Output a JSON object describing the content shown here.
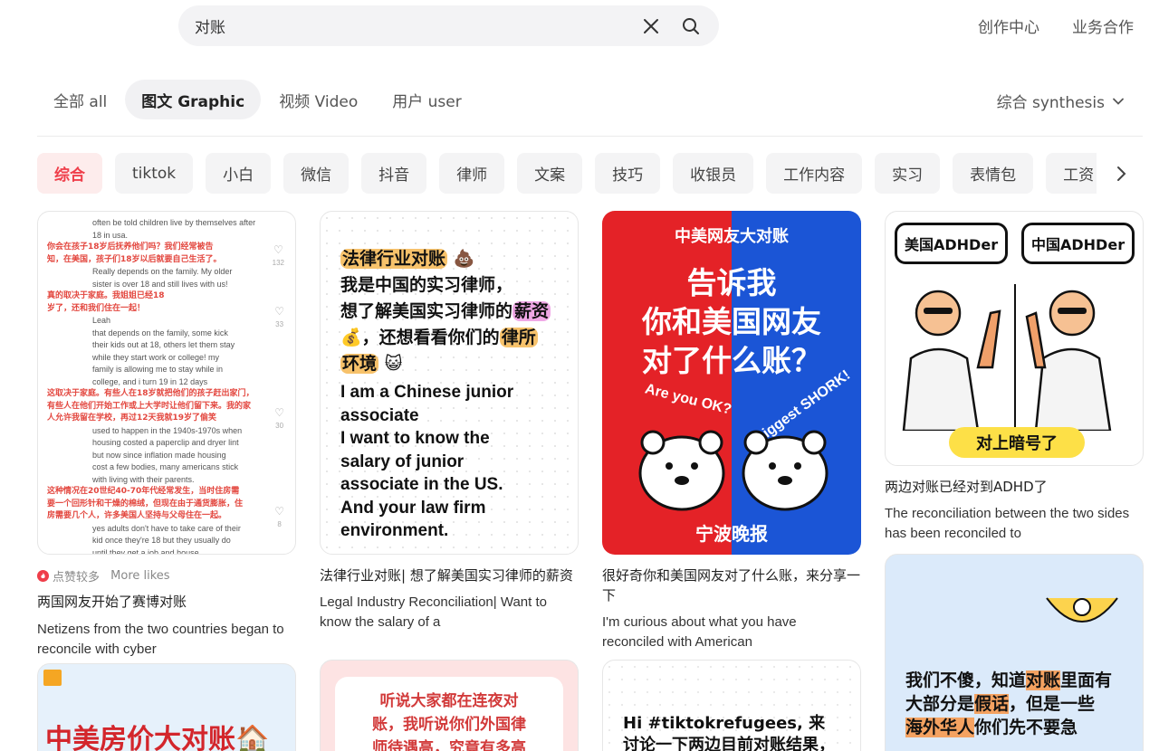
{
  "search": {
    "query": "对账"
  },
  "toplinks": [
    "创作中心",
    "业务合作"
  ],
  "tabs": [
    {
      "label": "全部  all",
      "active": false
    },
    {
      "label": "图文  Graphic",
      "active": true
    },
    {
      "label": "视频  Video",
      "active": false
    },
    {
      "label": "用户  user",
      "active": false
    }
  ],
  "sort_label": "综合  synthesis",
  "chips": [
    "综合",
    "tiktok",
    "小白",
    "微信",
    "抖音",
    "律师",
    "文案",
    "技巧",
    "收银员",
    "工作内容",
    "实习",
    "表情包",
    "工资"
  ],
  "cards": [
    {
      "likes_badge": "点赞较多",
      "likes_badge_en": "More likes",
      "title": "两国网友开始了赛博对账",
      "title_en": "Netizens from the two countries began to reconcile with cyber",
      "cover": {
        "lines": [
          {
            "t": "often be told children live by themselves after",
            "c": "en"
          },
          {
            "t": "18 in usa.",
            "c": "en"
          },
          {
            "t": "你会在孩子18岁后抚养他们吗？我们经常被告",
            "c": "red"
          },
          {
            "t": "知，在美国，孩子们18岁以后就要自己生活了。",
            "c": "red"
          },
          {
            "t": "Really depends on the family. My older",
            "c": "en"
          },
          {
            "t": "sister is over 18 and still lives with us!",
            "c": "en"
          },
          {
            "t": "真的取决于家庭。我姐姐已经18",
            "c": "red"
          },
          {
            "t": "岁了，还和我们住在一起！",
            "c": "red"
          },
          {
            "t": "Leah",
            "c": "en"
          },
          {
            "t": "that depends on the family, some kick",
            "c": "en"
          },
          {
            "t": "their kids out at 18, others let them stay",
            "c": "en"
          },
          {
            "t": "while they start work or college! my",
            "c": "en"
          },
          {
            "t": "family is allowing me to stay while in",
            "c": "en"
          },
          {
            "t": "college, and i turn 19 in 12 days",
            "c": "en"
          },
          {
            "t": "这取决于家庭。有些人在18岁就把他们的孩子赶出家门，",
            "c": "red"
          },
          {
            "t": "有些人在他们开始工作或上大学时让他们留下来。我的家",
            "c": "red"
          },
          {
            "t": "人允许我留在学校，再过12天我就19岁了偷笑",
            "c": "red"
          },
          {
            "t": "used to happen in the 1940s-1970s when",
            "c": "en"
          },
          {
            "t": "housing costed a paperclip and dryer lint",
            "c": "en"
          },
          {
            "t": "but now since inflation made housing",
            "c": "en"
          },
          {
            "t": "cost a few bodies, many americans stick",
            "c": "en"
          },
          {
            "t": "with living with their parents.",
            "c": "en"
          },
          {
            "t": "这种情况在20世纪40-70年代经常发生，当时住房需",
            "c": "red"
          },
          {
            "t": "要一个回形针和干燥的棉绒，但现在由于通货膨胀，住",
            "c": "red"
          },
          {
            "t": "房需要几个人，许多美国人坚持与父母住在一起。",
            "c": "red"
          },
          {
            "t": "yes adults don't have to take care of their",
            "c": "en"
          },
          {
            "t": "kid once they're 18 but they usually do",
            "c": "en"
          },
          {
            "t": "until they get a job and house",
            "c": "en"
          }
        ],
        "heart_counts": [
          "132",
          "33",
          "30",
          "8"
        ]
      }
    },
    {
      "title": "法律行业对账| 想了解美国实习律师的薪资",
      "title_en": "Legal Industry Reconciliation| Want to know the salary of a",
      "cover": {
        "zh1": "法律行业对账",
        "zh2": "我是中国的实习律师，",
        "zh3a": "想了解美国实习律师的",
        "zh3b": "薪资",
        "zh4a": "，还想看看你们的",
        "zh4b": "律所",
        "zh5": "环境",
        "en": [
          "I am a Chinese junior",
          "associate",
          "I want to know the",
          "salary of junior",
          "associate in the US.",
          "And your law firm",
          "environment."
        ]
      }
    },
    {
      "title": "很好奇你和美国网友对了什么账，来分享一下",
      "title_en": "I'm curious about what you have reconciled with American",
      "cover": {
        "top": "中美网友大对账",
        "big": [
          "告诉我",
          "你和美国网友",
          "对了什么账？"
        ],
        "left_tag": "Are you OK?",
        "right_tag": "biggest SHORK!",
        "sign": "宁波晚报"
      }
    },
    {
      "title": "两边对账已经对到ADHD了",
      "title_en": "The reconciliation between the two sides has been reconciled to",
      "cover": {
        "left_bubble": "美国ADHDer",
        "right_bubble": "中国ADHDer",
        "tag": "对上暗号了"
      }
    },
    {
      "cover": {
        "text": "中美房价大对账"
      }
    },
    {
      "cover": {
        "lines": [
          "听说大家都在连夜对",
          "账，我听说你们外国律",
          "师待遇高，究竟有多高"
        ]
      }
    },
    {
      "cover": {
        "lines": [
          "Hi #tiktokrefugees, 来",
          "讨论一下两边目前对账结果，"
        ]
      }
    },
    {
      "cover": {
        "l1a": "我们不傻，知道",
        "l1b": "对账",
        "l1c": "里面有",
        "l2a": "大部分是",
        "l2b": "假话",
        "l2c": "，但是一些",
        "l3a": "海外华人",
        "l3b": "你们先不要急"
      }
    }
  ]
}
